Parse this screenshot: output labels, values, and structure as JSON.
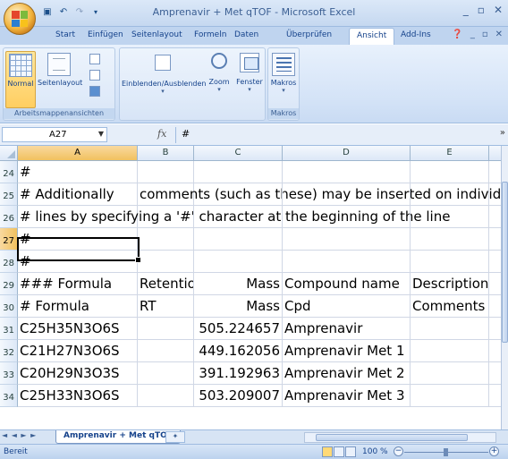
{
  "window": {
    "title": "Amprenavir  + Met qTOF - Microsoft Excel"
  },
  "ribbon": {
    "tabs": [
      "Start",
      "Einfügen",
      "Seitenlayout",
      "Formeln",
      "Daten",
      "Überprüfen",
      "Ansicht",
      "Add-Ins"
    ],
    "active_tab": "Ansicht",
    "groups": {
      "arbeitsmappen": {
        "label": "Arbeitsmappenansichten",
        "normal": "Normal",
        "seitenlayout": "Seitenlayout"
      },
      "fenster": {
        "einblenden": "Einblenden/Ausblenden",
        "zoom": "Zoom",
        "fenster": "Fenster"
      },
      "makros": {
        "button": "Makros",
        "label": "Makros"
      }
    }
  },
  "formula_bar": {
    "name_box": "A27",
    "fx": "fx",
    "value": "#"
  },
  "sheet": {
    "columns": [
      "A",
      "B",
      "C",
      "D",
      "E",
      "F"
    ],
    "active_column": "A",
    "rows": [
      {
        "num": "24",
        "cells": [
          "#",
          "",
          "",
          "",
          "",
          ""
        ]
      },
      {
        "num": "25",
        "cells": [
          "# Additionally",
          "comments (such as these) may be inserted on individual",
          "",
          "",
          "",
          ""
        ]
      },
      {
        "num": "26",
        "cells": [
          "# lines by specifying a '#' character at the beginning of the line",
          "",
          "",
          "",
          "",
          ""
        ]
      },
      {
        "num": "27",
        "cells": [
          "#",
          "",
          "",
          "",
          "",
          ""
        ]
      },
      {
        "num": "28",
        "cells": [
          "#",
          "",
          "",
          "",
          "",
          ""
        ]
      },
      {
        "num": "29",
        "cells": [
          "### Formula",
          "Retention Time",
          "Mass",
          "Compound name",
          "Description",
          ""
        ]
      },
      {
        "num": "30",
        "cells": [
          "# Formula",
          "RT",
          "Mass",
          "Cpd",
          "Comments",
          ""
        ]
      },
      {
        "num": "31",
        "cells": [
          "C25H35N3O6S",
          "",
          "505.224657",
          "Amprenavir",
          "",
          ""
        ]
      },
      {
        "num": "32",
        "cells": [
          "C21H27N3O6S",
          "",
          "449.162056",
          "Amprenavir Met 1",
          "",
          ""
        ]
      },
      {
        "num": "33",
        "cells": [
          "C20H29N3O3S",
          "",
          "391.192963",
          "Amprenavir Met 2",
          "",
          ""
        ]
      },
      {
        "num": "34",
        "cells": [
          "C25H33N3O6S",
          "",
          "503.209007",
          "Amprenavir Met 3",
          "",
          ""
        ]
      }
    ],
    "active_row": "27"
  },
  "sheet_tabs": {
    "nav": "◄ ◄ ► ►",
    "active": "Amprenavir  + Met qTOF"
  },
  "status": {
    "text": "Bereit",
    "zoom": "100 %"
  },
  "icons": {
    "qat": [
      "save-icon",
      "undo-icon",
      "redo-icon"
    ],
    "minimize": "‒",
    "restore": "▫",
    "close": "✕"
  }
}
